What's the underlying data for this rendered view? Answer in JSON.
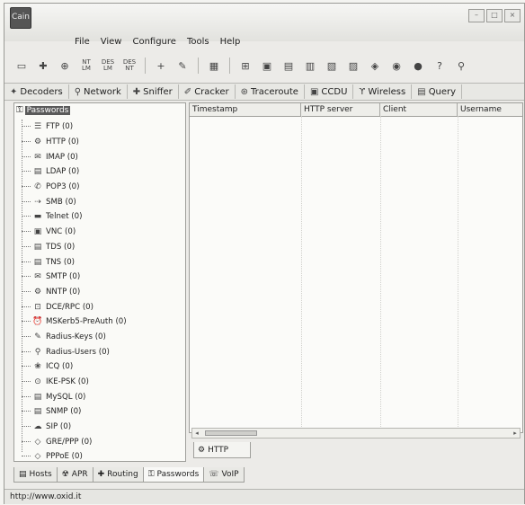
{
  "app": {
    "logo_text": "Cain"
  },
  "menu": [
    "File",
    "View",
    "Configure",
    "Tools",
    "Help"
  ],
  "toolbar_icons": [
    "open-icon",
    "network-icon",
    "sniffer-icon",
    "hash-icon",
    "hash-icon",
    "hash-icon",
    "plus-icon",
    "remove-icon",
    "decode-icon",
    "route-icon",
    "tool-icon",
    "tool-icon",
    "tool-icon",
    "tool-icon",
    "tool-icon",
    "tool-icon",
    "tool-icon",
    "info-icon",
    "help-icon",
    "exit-icon"
  ],
  "top_tabs": [
    {
      "icon": "decoders-icon",
      "label": "Decoders"
    },
    {
      "icon": "network-icon",
      "label": "Network"
    },
    {
      "icon": "sniffer-icon",
      "label": "Sniffer"
    },
    {
      "icon": "cracker-icon",
      "label": "Cracker"
    },
    {
      "icon": "traceroute-icon",
      "label": "Traceroute"
    },
    {
      "icon": "ccdu-icon",
      "label": "CCDU"
    },
    {
      "icon": "wireless-icon",
      "label": "Wireless"
    },
    {
      "icon": "query-icon",
      "label": "Query"
    }
  ],
  "tree": {
    "root": "Passwords",
    "items": [
      "FTP (0)",
      "HTTP (0)",
      "IMAP (0)",
      "LDAP (0)",
      "POP3 (0)",
      "SMB (0)",
      "Telnet (0)",
      "VNC (0)",
      "TDS (0)",
      "TNS (0)",
      "SMTP (0)",
      "NNTP (0)",
      "DCE/RPC (0)",
      "MSKerb5-PreAuth (0)",
      "Radius-Keys (0)",
      "Radius-Users (0)",
      "ICQ (0)",
      "IKE-PSK (0)",
      "MySQL (0)",
      "SNMP (0)",
      "SIP (0)",
      "GRE/PPP (0)",
      "PPPoE (0)"
    ]
  },
  "table": {
    "columns": [
      "Timestamp",
      "HTTP server",
      "Client",
      "Username"
    ]
  },
  "subtab": "HTTP",
  "bottom_tabs": [
    {
      "icon": "hosts-icon",
      "label": "Hosts"
    },
    {
      "icon": "apr-icon",
      "label": "APR"
    },
    {
      "icon": "routing-icon",
      "label": "Routing"
    },
    {
      "icon": "passwords-icon",
      "label": "Passwords",
      "active": true
    },
    {
      "icon": "voip-icon",
      "label": "VoIP"
    }
  ],
  "status": "http://www.oxid.it"
}
